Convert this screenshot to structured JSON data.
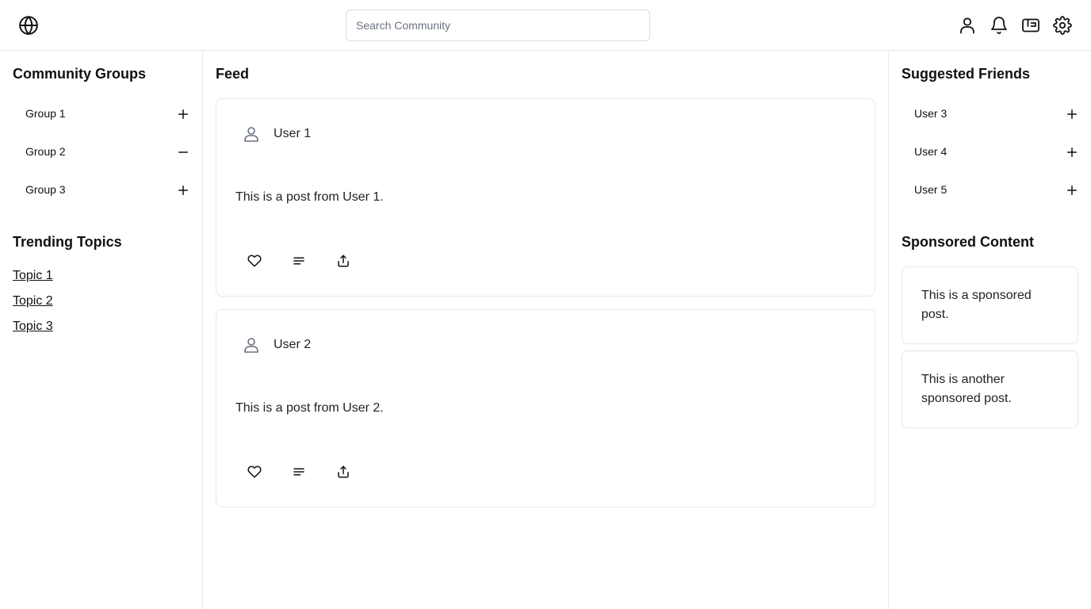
{
  "header": {
    "logo_icon": "globe-icon",
    "search_placeholder": "Search Community",
    "icons": [
      "user-icon",
      "bell-icon",
      "wallet-icon",
      "settings-icon"
    ]
  },
  "left_sidebar": {
    "groups_title": "Community Groups",
    "groups": [
      {
        "label": "Group 1",
        "action_icon": "plus-icon"
      },
      {
        "label": "Group 2",
        "action_icon": "minus-icon"
      },
      {
        "label": "Group 3",
        "action_icon": "plus-icon"
      }
    ],
    "topics_title": "Trending Topics",
    "topics": [
      "Topic 1",
      "Topic 2",
      "Topic 3"
    ]
  },
  "feed": {
    "title": "Feed",
    "posts": [
      {
        "user": "User 1",
        "content": "This is a post from User 1.",
        "actions": [
          "heart-icon",
          "comment-icon",
          "share-icon"
        ]
      },
      {
        "user": "User 2",
        "content": "This is a post from User 2.",
        "actions": [
          "heart-icon",
          "comment-icon",
          "share-icon"
        ]
      }
    ]
  },
  "right_sidebar": {
    "friends_title": "Suggested Friends",
    "friends": [
      {
        "label": "User 3",
        "action_icon": "plus-icon"
      },
      {
        "label": "User 4",
        "action_icon": "plus-icon"
      },
      {
        "label": "User 5",
        "action_icon": "plus-icon"
      }
    ],
    "sponsored_title": "Sponsored Content",
    "sponsored": [
      "This is a sponsored post.",
      "This is another sponsored post."
    ]
  },
  "colors": {
    "border": "#e5e7eb",
    "text": "#111111",
    "muted": "#6b7280"
  }
}
